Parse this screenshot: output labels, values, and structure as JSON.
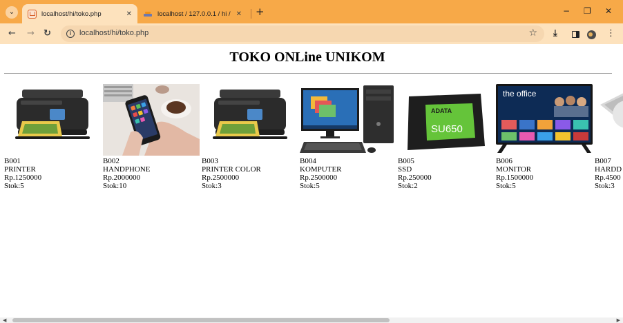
{
  "browser": {
    "tabs": [
      {
        "title": "localhost/hi/toko.php",
        "active": true
      },
      {
        "title": "localhost / 127.0.0.1 / hi / barar",
        "active": false
      }
    ],
    "new_tab_label": "+",
    "address": "localhost/hi/toko.php",
    "window_controls": {
      "minimize": "−",
      "restore": "❐",
      "close": "✕"
    }
  },
  "page": {
    "title": "TOKO ONLine UNIKOM",
    "products": [
      {
        "code": "B001",
        "name": "PRINTER",
        "price": "Rp.1250000",
        "stock": "Stok:5",
        "image": "printer-image"
      },
      {
        "code": "B002",
        "name": "HANDPHONE",
        "price": "Rp.2000000",
        "stock": "Stok:10",
        "image": "handphone-image"
      },
      {
        "code": "B003",
        "name": "PRINTER COLOR",
        "price": "Rp.2500000",
        "stock": "Stok:3",
        "image": "printer-color-image"
      },
      {
        "code": "B004",
        "name": "KOMPUTER",
        "price": "Rp.2500000",
        "stock": "Stok:5",
        "image": "komputer-image"
      },
      {
        "code": "B005",
        "name": "SSD",
        "price": "Rp.250000",
        "stock": "Stok:2",
        "image": "ssd-image",
        "image_text": {
          "brand": "ADATA",
          "model": "SU650"
        }
      },
      {
        "code": "B006",
        "name": "MONITOR",
        "price": "Rp.1500000",
        "stock": "Stok:5",
        "image": "monitor-image",
        "image_text": {
          "screen": "the office"
        }
      },
      {
        "code": "B007",
        "name": "HARDD",
        "price": "Rp.4500",
        "stock": "Stok:3",
        "image": "harddisk-image"
      }
    ]
  },
  "colors": {
    "tabbar": "#f7a948",
    "toolbar": "#fde2bd",
    "omnibox": "#f6d7b0"
  }
}
